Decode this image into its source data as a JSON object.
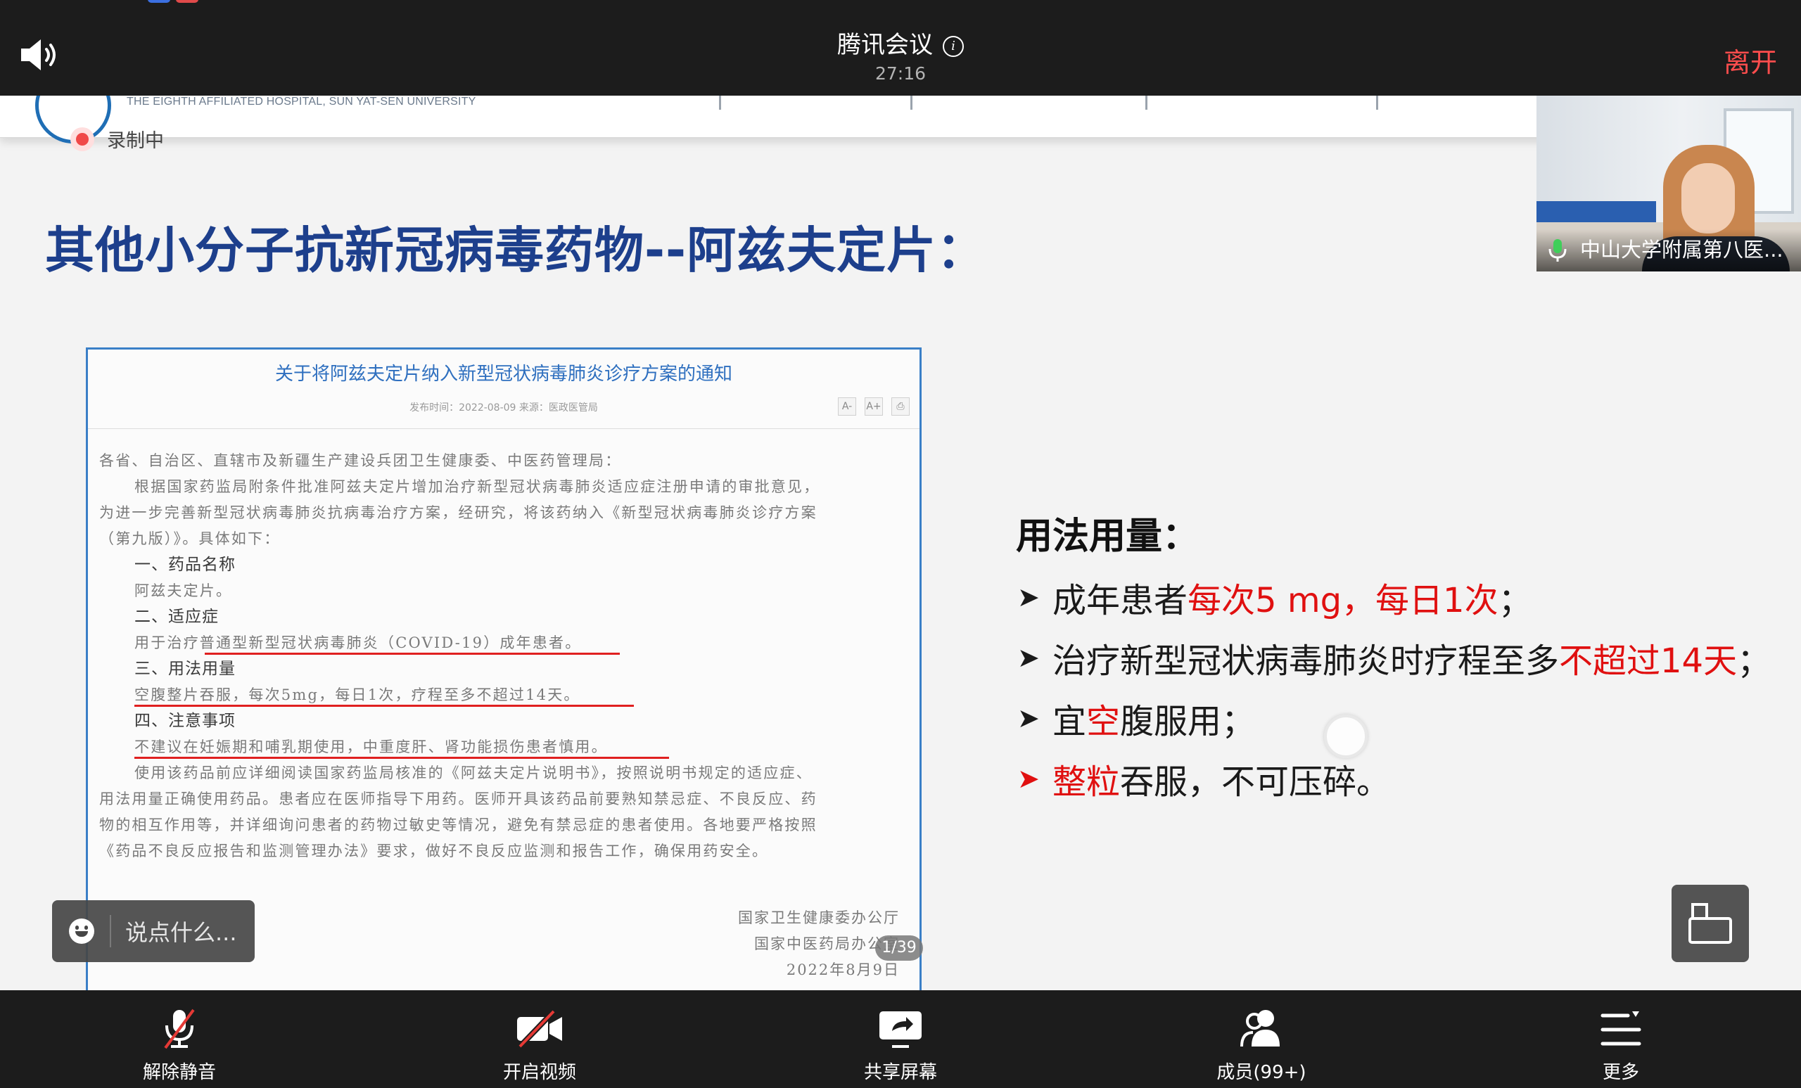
{
  "topbar": {
    "title": "腾讯会议",
    "timer": "27:16",
    "leave_label": "离开"
  },
  "recording": {
    "label": "录制中"
  },
  "slide": {
    "hospital_en": "THE EIGHTH AFFILIATED HOSPITAL, SUN YAT-SEN UNIVERSITY",
    "title": "其他小分子抗新冠病毒药物--阿兹夫定片：",
    "document": {
      "title": "关于将阿兹夫定片纳入新型冠状病毒肺炎诊疗方案的通知",
      "meta": "发布时间：2022-08-09    来源：医政医管局",
      "tools": [
        "A-",
        "A+",
        "⎙"
      ],
      "lines": [
        "各省、自治区、直辖市及新疆生产建设兵团卫生健康委、中医药管理局：",
        "根据国家药监局附条件批准阿兹夫定片增加治疗新型冠状病毒肺炎适应症注册申请的审批意见，",
        "为进一步完善新型冠状病毒肺炎抗病毒治疗方案，经研究，将该药纳入《新型冠状病毒肺炎诊疗方案",
        "（第九版）》。具体如下：",
        "一、药品名称",
        "阿兹夫定片。",
        "二、适应症",
        "用于治疗普通型新型冠状病毒肺炎（COVID-19）成年患者。",
        "三、用法用量",
        "空腹整片吞服，每次5mg，每日1次，疗程至多不超过14天。",
        "四、注意事项",
        "不建议在妊娠期和哺乳期使用，中重度肝、肾功能损伤患者慎用。",
        "使用该药品前应详细阅读国家药监局核准的《阿兹夫定片说明书》，按照说明书规定的适应症、",
        "用法用量正确使用药品。患者应在医师指导下用药。医师开具该药品前要熟知禁忌症、不良反应、药",
        "物的相互作用等，并详细询问患者的药物过敏史等情况，避免有禁忌症的患者使用。各地要严格按照",
        "《药品不良反应报告和监测管理办法》要求，做好不良反应监测和报告工作，确保用药安全。"
      ],
      "sign": [
        "国家卫生健康委办公厅",
        "国家中医药局办公室",
        "2022年8月9日"
      ]
    },
    "page_indicator": "1/39",
    "usage": {
      "heading": "用法用量：",
      "items": [
        {
          "pre": "成年患者",
          "red": "每次5 mg，每日1次",
          "post": "；"
        },
        {
          "pre": "治疗新型冠状病毒肺炎时疗程至多",
          "red": "不超过14天",
          "post": "；"
        },
        {
          "pre": "宜",
          "red": "空",
          "post": "腹服用；"
        },
        {
          "pre": "",
          "red": "整粒",
          "post": "吞服，不可压碎。"
        }
      ]
    }
  },
  "participant": {
    "name": "中山大学附属第八医..."
  },
  "chat": {
    "placeholder": "说点什么..."
  },
  "toolbar": {
    "unmute": "解除静音",
    "video": "开启视频",
    "share": "共享屏幕",
    "members": "成员(99+)",
    "more": "更多"
  },
  "colors": {
    "title_blue": "#1d3f8c",
    "accent_red": "#e01010",
    "leave_red": "#ff4d4d",
    "bar_bg": "#1c1c1c"
  }
}
